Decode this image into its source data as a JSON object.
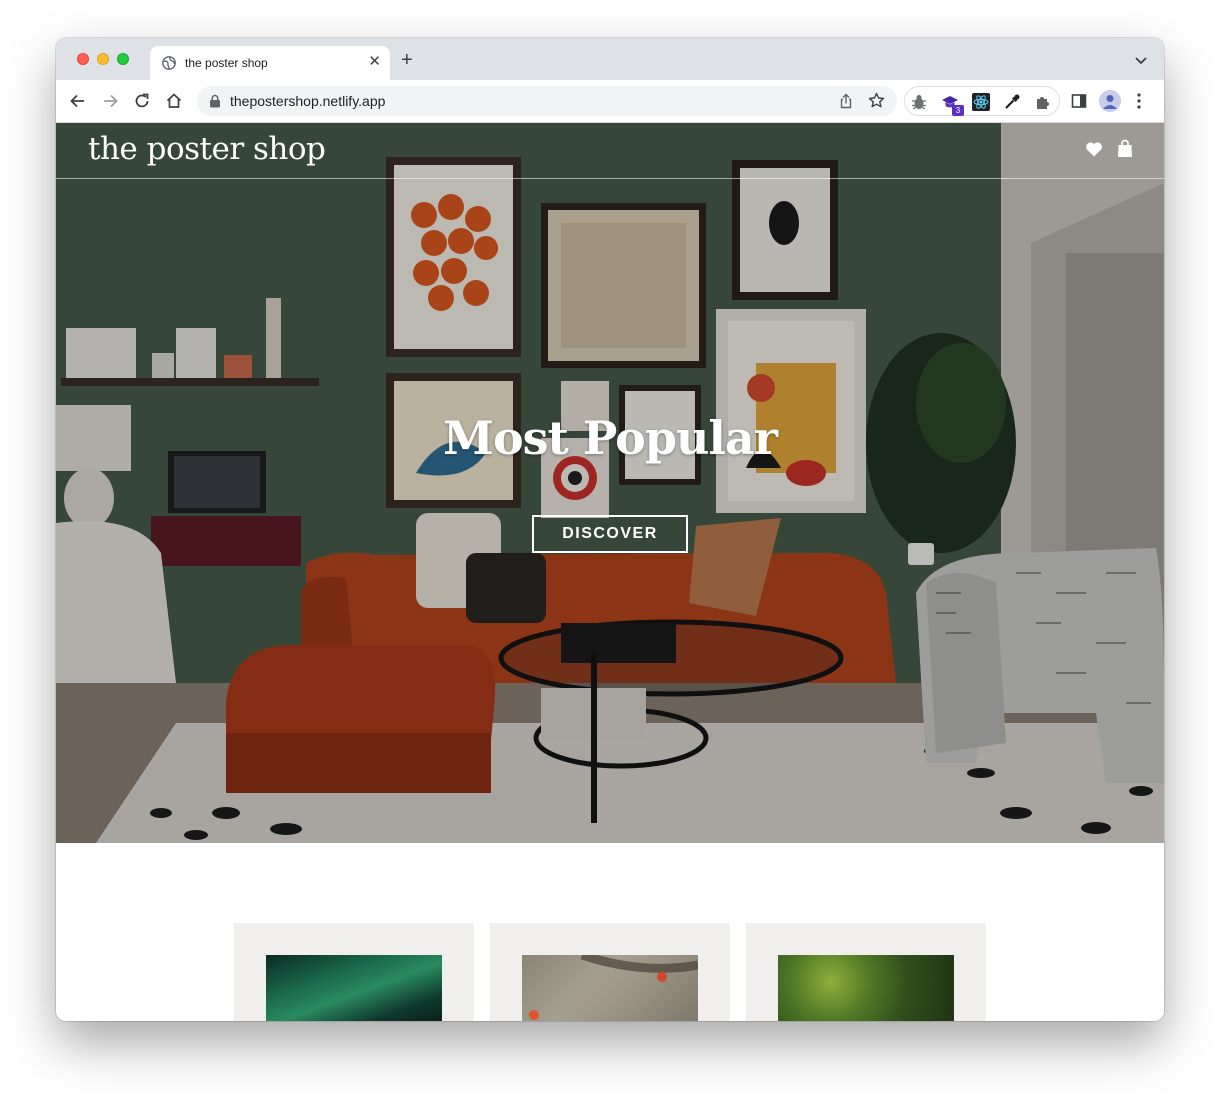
{
  "browser": {
    "tab_title": "the poster shop",
    "url": "thepostershop.netlify.app",
    "extension_badge": "3"
  },
  "site": {
    "logo": "the poster shop"
  },
  "hero": {
    "title": "Most Popular",
    "button_label": "DISCOVER"
  },
  "products": [
    {
      "image": "aurora-poster"
    },
    {
      "image": "autumn-branch-poster"
    },
    {
      "image": "green-leaves-poster"
    }
  ],
  "colors": {
    "tab_strip": "#dee1e6",
    "wall_green": "#4a5d4b",
    "sofa_orange": "#b6441f",
    "card_bg": "#f0efed"
  }
}
